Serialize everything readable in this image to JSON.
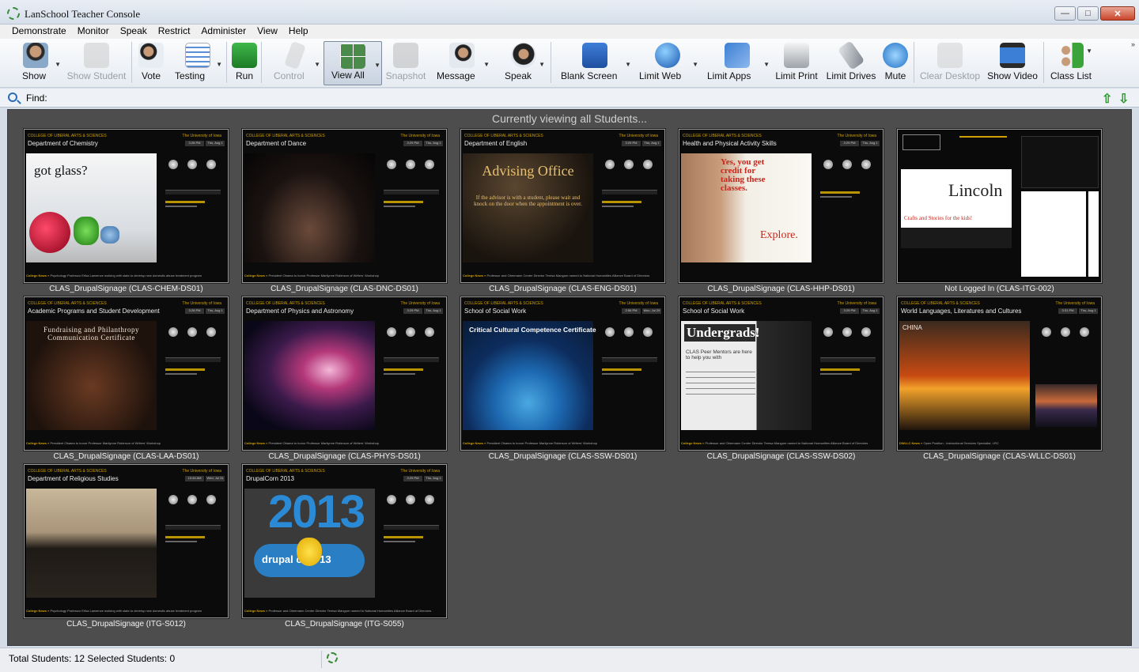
{
  "window": {
    "title": "LanSchool Teacher Console",
    "icon": "lanschool-icon"
  },
  "menu": [
    "Demonstrate",
    "Monitor",
    "Speak",
    "Restrict",
    "Administer",
    "View",
    "Help"
  ],
  "toolbar": {
    "buttons": [
      {
        "label": "Show",
        "icon": "show-icon",
        "enabled": true,
        "dropdown": true
      },
      {
        "label": "Show Student",
        "icon": "show-student-icon",
        "enabled": false,
        "dropdown": false
      },
      {
        "label": "Vote",
        "icon": "vote-icon",
        "enabled": true,
        "dropdown": false
      },
      {
        "label": "Testing",
        "icon": "testing-icon",
        "enabled": true,
        "dropdown": true
      },
      {
        "label": "Run",
        "icon": "run-icon",
        "enabled": true,
        "dropdown": false
      },
      {
        "label": "Control",
        "icon": "control-icon",
        "enabled": false,
        "dropdown": true
      },
      {
        "label": "View All",
        "icon": "view-all-icon",
        "enabled": true,
        "dropdown": true,
        "active": true
      },
      {
        "label": "Snapshot",
        "icon": "snapshot-icon",
        "enabled": false,
        "dropdown": false
      },
      {
        "label": "Message",
        "icon": "message-icon",
        "enabled": true,
        "dropdown": true
      },
      {
        "label": "Speak",
        "icon": "speak-icon",
        "enabled": true,
        "dropdown": true
      },
      {
        "label": "Blank Screen",
        "icon": "blank-screen-icon",
        "enabled": true,
        "dropdown": true
      },
      {
        "label": "Limit Web",
        "icon": "limit-web-icon",
        "enabled": true,
        "dropdown": true
      },
      {
        "label": "Limit Apps",
        "icon": "limit-apps-icon",
        "enabled": true,
        "dropdown": true
      },
      {
        "label": "Limit Print",
        "icon": "limit-print-icon",
        "enabled": true,
        "dropdown": false
      },
      {
        "label": "Limit Drives",
        "icon": "limit-drives-icon",
        "enabled": true,
        "dropdown": false
      },
      {
        "label": "Mute",
        "icon": "mute-icon",
        "enabled": true,
        "dropdown": false
      },
      {
        "label": "Clear Desktop",
        "icon": "clear-desktop-icon",
        "enabled": false,
        "dropdown": false
      },
      {
        "label": "Show Video",
        "icon": "show-video-icon",
        "enabled": true,
        "dropdown": false
      },
      {
        "label": "Class List",
        "icon": "class-list-icon",
        "enabled": true,
        "dropdown": true
      }
    ]
  },
  "find": {
    "label": "Find:",
    "value": ""
  },
  "main": {
    "caption": "Currently viewing all Students...",
    "students": [
      {
        "name": "CLAS_DrupalSignage (CLAS-CHEM-DS01)",
        "dept": "Department of Chemistry",
        "image_title": "got glass?",
        "ticker": "Psychology Professor Erika Lawrence working with state to develop new domestic abuse treatment program",
        "clock": "3:28 PM",
        "date": "Thu, Aug 1"
      },
      {
        "name": "CLAS_DrupalSignage (CLAS-DNC-DS01)",
        "dept": "Department of Dance",
        "image_title": "",
        "ticker": "President Obama to honor Professor Marilynne Robinson of Writers' Workshop",
        "clock": "3:29 PM",
        "date": "Thu, Aug 1"
      },
      {
        "name": "CLAS_DrupalSignage (CLAS-ENG-DS01)",
        "dept": "Department of English",
        "image_title": "Advising Office",
        "image_sub": "If the advisor is with a student, please wait and knock on the door when the appointment is over.",
        "ticker": "Professor and Obermann Center Director Teresa Mangum named to National Humanities Alliance Board of Directors",
        "clock": "3:29 PM",
        "date": "Thu, Aug 1"
      },
      {
        "name": "CLAS_DrupalSignage (CLAS-HHP-DS01)",
        "dept": "Health and Physical Activity Skills",
        "image_title": "Yes, you get credit for taking these classes.",
        "image_sub": "Explore.",
        "ticker": "",
        "clock": "3:29 PM",
        "date": "Thu, Aug 1"
      },
      {
        "name": "Not Logged In (CLAS-ITG-002)",
        "dept": "",
        "image_title": "Lincoln",
        "image_sub": "Crafts and Stories for the kids!",
        "ticker": "",
        "clock": "",
        "date": ""
      },
      {
        "name": "CLAS_DrupalSignage (CLAS-LAA-DS01)",
        "dept": "Academic Programs and Student Development",
        "image_title": "Fundraising and Philanthropy Communication Certificate",
        "ticker": "President Obama to honor Professor Marilynne Robinson of Writers' Workshop",
        "clock": "3:28 PM",
        "date": "Thu, Aug 1"
      },
      {
        "name": "CLAS_DrupalSignage (CLAS-PHYS-DS01)",
        "dept": "Department of Physics and Astronomy",
        "image_title": "",
        "ticker": "President Obama to honor Professor Marilynne Robinson of Writers' Workshop",
        "clock": "3:29 PM",
        "date": "Thu, Aug 1"
      },
      {
        "name": "CLAS_DrupalSignage (CLAS-SSW-DS01)",
        "dept": "School of Social Work",
        "image_title": "Critical Cultural Competence Certificate",
        "ticker": "President Obama to honor Professor Marilynne Robinson of Writers' Workshop",
        "clock": "2:56 PM",
        "date": "Mon, Jul 29"
      },
      {
        "name": "CLAS_DrupalSignage (CLAS-SSW-DS02)",
        "dept": "School of Social Work",
        "image_title": "Undergrads!",
        "image_sub": "CLAS Peer Mentors are here to help you with",
        "ticker": "Professor and Obermann Center Director Teresa Mangum named to National Humanities Alliance Board of Directors",
        "clock": "3:29 PM",
        "date": "Thu, Aug 1"
      },
      {
        "name": "CLAS_DrupalSignage (CLAS-WLLC-DS01)",
        "dept": "World Languages, Literatures and Cultures",
        "image_title": "CHINA",
        "ticker": "Open Position - Instructional Services Specialist, LRC",
        "clock": "3:31 PM",
        "date": "Thu, Aug 1"
      },
      {
        "name": "CLAS_DrupalSignage (ITG-S012)",
        "dept": "Department of Religious Studies",
        "image_title": "",
        "ticker": "Psychology Professor Erika Lawrence working with state to develop new domestic abuse treatment program",
        "clock": "10:44 AM",
        "date": "Wed, Jul 31"
      },
      {
        "name": "CLAS_DrupalSignage (ITG-S055)",
        "dept": "DrupalCorn 2013",
        "image_title": "2013",
        "image_sub": "drupal com'13",
        "ticker": "Professor and Obermann Center Director Teresa Mangum named to National Humanities Alliance Board of Directors",
        "clock": "3:29 PM",
        "date": "Thu, Aug 1"
      }
    ]
  },
  "status": {
    "totals": "Total Students: 12  Selected Students: 0"
  },
  "colors": {
    "grid_bg": "#4d4d4d",
    "accent_gold": "#d0a000",
    "caption": "#f2f2f2"
  }
}
